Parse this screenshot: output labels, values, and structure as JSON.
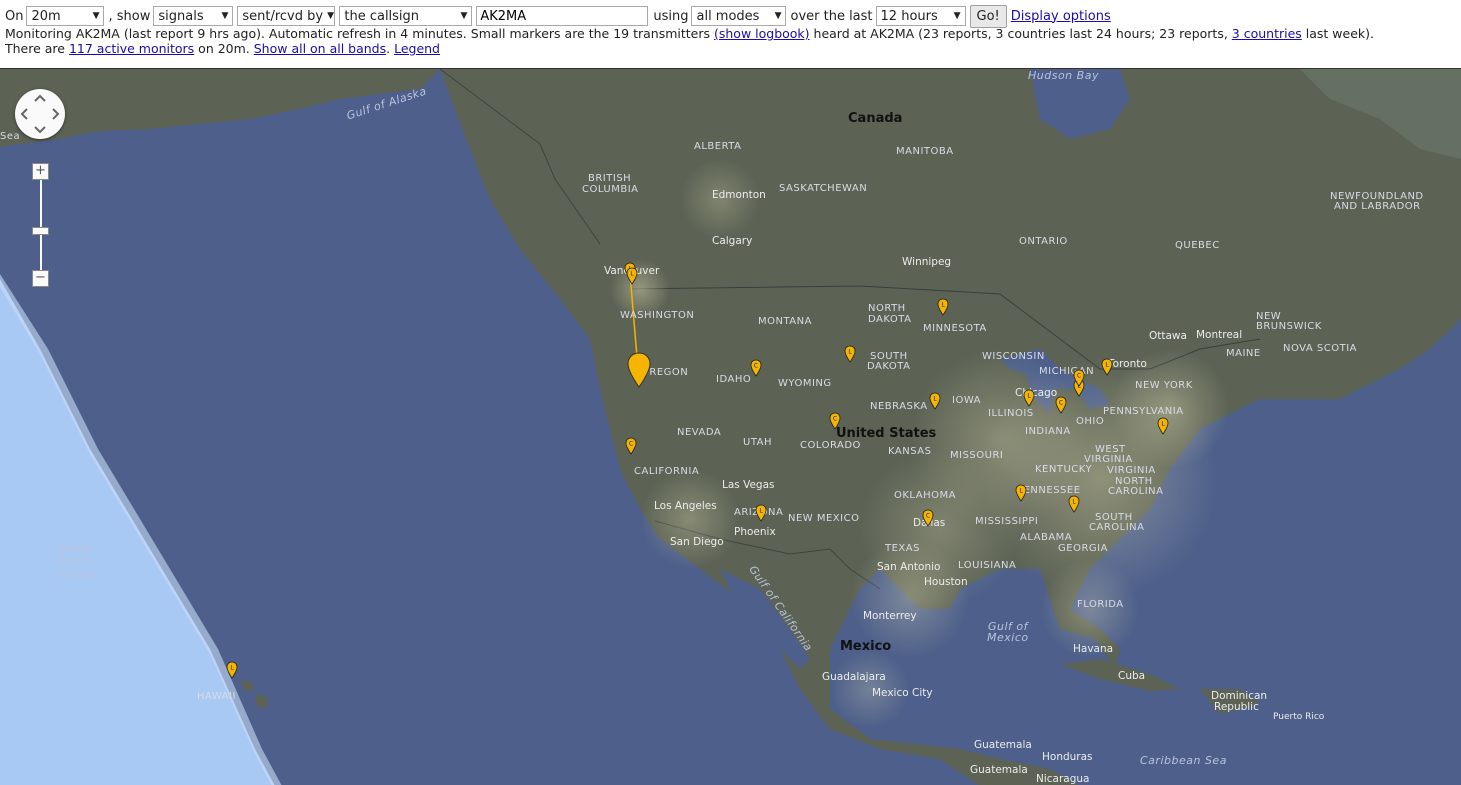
{
  "controls": {
    "on_label": "On",
    "band": "20m",
    "show_label": ", show",
    "show_value": "signals",
    "direction": "sent/rcvd by",
    "target": "the callsign",
    "callsign": "AK2MA",
    "using_label": "using",
    "modes": "all modes",
    "over_label": "over the last",
    "period": "12 hours",
    "go_label": "Go!",
    "display_options": "Display options"
  },
  "status": {
    "line1_a": "Monitoring AK2MA (last report 9 hrs ago). Automatic refresh in 4 minutes. Small markers are the 19 transmitters ",
    "show_logbook": "(show logbook)",
    "line1_b": " heard at AK2MA (23 reports, 3 countries last 24 hours; 23 reports, ",
    "countries_link": "3 countries",
    "line1_c": " last week).",
    "line2_a": "There are ",
    "monitors_link": "117 active monitors",
    "line2_b": " on 20m. ",
    "show_all": "Show all on all bands",
    "line2_c": ". ",
    "legend": "Legend"
  },
  "map": {
    "zoom_in": "+",
    "zoom_out": "−",
    "labels": {
      "hudson_bay": "Hudson Bay",
      "gulf_alaska": "Gulf of Alaska",
      "canada": "Canada",
      "alberta": "ALBERTA",
      "manitoba": "MANITOBA",
      "british_columbia_1": "BRITISH",
      "british_columbia_2": "COLUMBIA",
      "saskatchewan": "SASKATCHEWAN",
      "edmonton": "Edmonton",
      "calgary": "Calgary",
      "winnipeg": "Winnipeg",
      "ontario": "ONTARIO",
      "quebec": "QUEBEC",
      "newfoundland_1": "NEWFOUNDLAND",
      "newfoundland_2": "AND LABRADOR",
      "vancouver": "Vancouver",
      "washington": "WASHINGTON",
      "montana": "MONTANA",
      "north_dakota_1": "NORTH",
      "north_dakota_2": "DAKOTA",
      "minnesota": "MINNESOTA",
      "ottawa": "Ottawa",
      "montreal": "Montreal",
      "new_brunswick_1": "NEW",
      "new_brunswick_2": "BRUNSWICK",
      "nova_scotia": "NOVA SCOTIA",
      "maine": "MAINE",
      "oregon": "OREGON",
      "idaho": "IDAHO",
      "wyoming": "WYOMING",
      "south_dakota_1": "SOUTH",
      "south_dakota_2": "DAKOTA",
      "wisconsin": "WISCONSIN",
      "michigan": "MICHIGAN",
      "toronto": "Toronto",
      "new_york": "NEW YORK",
      "nebraska": "NEBRASKA",
      "iowa": "IOWA",
      "chicago": "Chicago",
      "illinois": "ILLINOIS",
      "indiana": "INDIANA",
      "ohio": "OHIO",
      "pennsylvania": "PENNSYLVANIA",
      "nevada": "NEVADA",
      "utah": "UTAH",
      "colorado": "COLORADO",
      "united_states": "United States",
      "kansas": "KANSAS",
      "missouri": "MISSOURI",
      "west_virginia_1": "WEST",
      "west_virginia_2": "VIRGINIA",
      "virginia": "VIRGINIA",
      "kentucky": "KENTUCKY",
      "california": "CALIFORNIA",
      "las_vegas": "Las Vegas",
      "tennessee": "TENNESSEE",
      "north_carolina_1": "NORTH",
      "north_carolina_2": "CAROLINA",
      "oklahoma": "OKLAHOMA",
      "los_angeles": "Los Angeles",
      "arizona": "ARIZONA",
      "new_mexico": "NEW MEXICO",
      "phoenix": "Phoenix",
      "dallas": "Dallas",
      "mississippi": "MISSISSIPPI",
      "alabama": "ALABAMA",
      "south_carolina_1": "SOUTH",
      "south_carolina_2": "CAROLINA",
      "san_diego": "San Diego",
      "texas": "TEXAS",
      "georgia": "GEORGIA",
      "north_pacific_1": "North",
      "north_pacific_2": "Pacific",
      "north_pacific_3": "Ocean",
      "san_antonio": "San Antonio",
      "houston": "Houston",
      "louisiana": "LOUISIANA",
      "gulf_california": "Gulf of California",
      "florida": "FLORIDA",
      "monterrey": "Monterrey",
      "gulf_mexico_1": "Gulf of",
      "gulf_mexico_2": "Mexico",
      "mexico": "Mexico",
      "havana": "Havana",
      "cuba": "Cuba",
      "guadalajara": "Guadalajara",
      "mexico_city": "Mexico City",
      "hawaii": "HAWAII",
      "dominican_1": "Dominican",
      "dominican_2": "Republic",
      "puerto_rico": "Puerto Rico",
      "guatemala_country": "Guatemala",
      "honduras": "Honduras",
      "guatemala_city": "Guatemala",
      "caribbean": "Caribbean Sea",
      "nicaragua": "Nicaragua",
      "sea": "Sea"
    },
    "markers": [
      "L",
      "L",
      "C",
      "C",
      "L",
      "L",
      "C",
      "L",
      "L",
      "C",
      "L",
      "C",
      "L",
      "L",
      "L",
      "C",
      "L",
      "L",
      "L"
    ],
    "colors": {
      "marker": "#f4b400",
      "ocean": "#4d5f8a",
      "land": "#5c6355",
      "night": "#a9c9f5"
    }
  }
}
